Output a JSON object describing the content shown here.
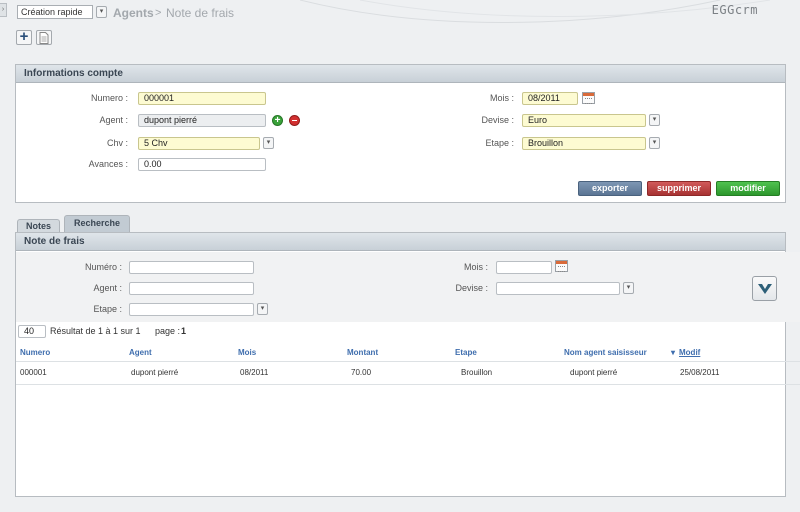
{
  "topbar": {
    "quick_create": "Création rapide",
    "breadcrumb_main": "Agents",
    "breadcrumb_sep": ">",
    "breadcrumb_sub": "Note de frais",
    "logo": "EGGcrm"
  },
  "account": {
    "title": "Informations compte",
    "numero_label": "Numero :",
    "numero_value": "000001",
    "agent_label": "Agent :",
    "agent_value": "dupont pierré",
    "chv_label": "Chv :",
    "chv_value": "5 Chv",
    "avances_label": "Avances :",
    "avances_value": "0.00",
    "mois_label": "Mois :",
    "mois_value": "08/2011",
    "devise_label": "Devise :",
    "devise_value": "Euro",
    "etape_label": "Etape :",
    "etape_value": "Brouillon",
    "export_label": "exporter",
    "delete_label": "supprimer",
    "modify_label": "modifier"
  },
  "tabs": [
    {
      "label": "Notes"
    },
    {
      "label": "Recherche"
    }
  ],
  "notes_panel": {
    "title": "Note de frais",
    "search": {
      "numero_label": "Numéro :",
      "agent_label": "Agent :",
      "etape_label": "Etape :",
      "mois_label": "Mois :",
      "devise_label": "Devise :"
    },
    "page_size": "40",
    "result_text": "Résultat de 1 à 1 sur 1",
    "page_label": "page :",
    "page_number": "1",
    "columns": [
      "Numero",
      "Agent",
      "Mois",
      "Montant",
      "Etape",
      "Nom agent saisisseur",
      "Modif"
    ],
    "rows": [
      [
        "000001",
        "dupont pierré",
        "08/2011",
        "70.00",
        "Brouillon",
        "dupont pierré",
        "25/08/2011"
      ]
    ]
  },
  "colors": {
    "accent_link": "#3f6eae",
    "required_field": "#fdfbd2",
    "export_button": "#6a84a3",
    "delete_button": "#bd4545",
    "modify_button": "#3aab3a"
  }
}
